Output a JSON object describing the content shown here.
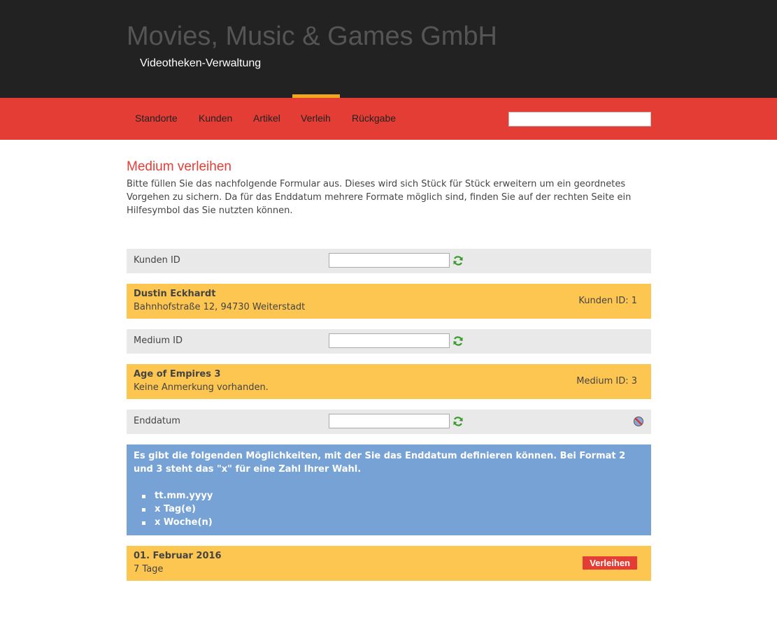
{
  "header": {
    "brand": "Movies, Music & Games GmbH",
    "subtitle": "Videotheken-Verwaltung"
  },
  "nav": {
    "items": [
      "Standorte",
      "Kunden",
      "Artikel",
      "Verleih",
      "Rückgabe"
    ],
    "active": "Verleih",
    "search_value": ""
  },
  "main": {
    "title": "Medium verleihen",
    "intro": "Bitte füllen Sie das nachfolgende Formular aus. Dieses wird sich Stück für Stück erweitern um ein geordnetes Vorgehen zu sichern. Da für das Enddatum mehrere Formate möglich sind, finden Sie auf der rechten Seite ein Hilfesymbol das Sie nutzten können."
  },
  "form": {
    "customer": {
      "label": "Kunden ID",
      "value": "",
      "result_name": "Dustin Eckhardt",
      "result_sub": "Bahnhofstraße 12, 94730 Weiterstadt",
      "result_right": "Kunden ID: 1"
    },
    "medium": {
      "label": "Medium ID",
      "value": "",
      "result_name": "Age of Empires 3",
      "result_sub": "Keine Anmerkung vorhanden.",
      "result_right": "Medium ID: 3"
    },
    "enddate": {
      "label": "Enddatum",
      "value": ""
    },
    "help": {
      "text": "Es gibt die folgenden Möglichkeiten, mit der Sie das Enddatum definieren können. Bei Format 2 und 3 steht das \"x\" für eine Zahl Ihrer Wahl.",
      "formats": [
        "tt.mm.yyyy",
        "x Tag(e)",
        "x Woche(n)"
      ]
    },
    "summary": {
      "date": "01. Februar 2016",
      "duration": "7 Tage",
      "button": "Verleihen"
    }
  },
  "colors": {
    "header_bg": "#222222",
    "nav_bg": "#e43d35",
    "accent": "#f2a81d",
    "info_yellow": "#fdc651",
    "help_blue": "#77a2d5",
    "refresh_green": "#3a9a2e"
  },
  "icons": [
    "refresh-icon",
    "help-icon"
  ]
}
